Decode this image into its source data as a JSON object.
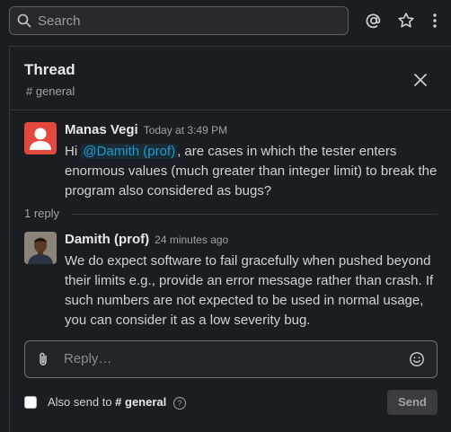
{
  "search": {
    "placeholder": "Search"
  },
  "topbar": {
    "icons": [
      "at-icon",
      "star-icon",
      "more-vertical-icon"
    ]
  },
  "thread": {
    "title": "Thread",
    "channel": "# general",
    "close_icon": "close-icon"
  },
  "messages": [
    {
      "author": "Manas Vegi",
      "time": "Today at 3:49 PM",
      "body_pre": "Hi ",
      "mention": "@Damith (prof)",
      "body_post": ", are cases in which the tester enters enormous values (much greater than integer limit) to break the program also considered as bugs?"
    },
    {
      "author": "Damith (prof)",
      "time": "24 minutes ago",
      "body": "We do expect software to fail gracefully when pushed beyond their limits e.g., provide an error message rather than crash. If such numbers are not expected to be used in normal usage, you can consider it as a low severity bug."
    }
  ],
  "replies_label": "1 reply",
  "composer": {
    "placeholder": "Reply…"
  },
  "also_send": {
    "prefix": "Also send to",
    "channel": "# general",
    "help": "?"
  },
  "send_label": "Send",
  "colors": {
    "background": "#1a1d21",
    "mention": "#1d9bd1",
    "avatar_default": "#e2483d"
  }
}
